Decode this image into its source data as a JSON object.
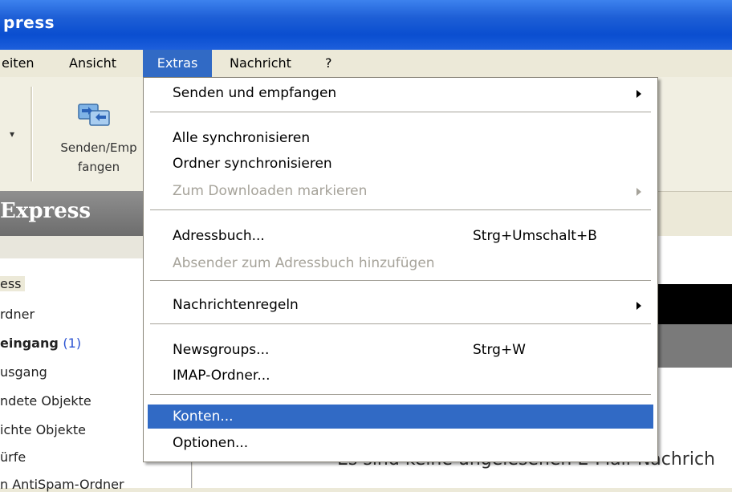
{
  "window": {
    "title": "press"
  },
  "menubar": {
    "items": [
      {
        "label": "eiten"
      },
      {
        "label": "Ansicht"
      },
      {
        "label": "Extras"
      },
      {
        "label": "Nachricht"
      },
      {
        "label": "?"
      }
    ]
  },
  "toolbar": {
    "send_receive_label_1": "Senden/Emp",
    "send_receive_label_2": "fangen"
  },
  "express_header": "Express",
  "folders": [
    {
      "label": "ess",
      "count": ""
    },
    {
      "label": "rdner",
      "count": ""
    },
    {
      "label": "eingang",
      "count": "(1)"
    },
    {
      "label": "usgang",
      "count": ""
    },
    {
      "label": "ndete Objekte",
      "count": ""
    },
    {
      "label": "ichte Objekte",
      "count": ""
    },
    {
      "label": "ürfe",
      "count": ""
    },
    {
      "label": "n AntiSpam-Ordner",
      "count": ""
    }
  ],
  "content": {
    "text": "Es sind keine ungelesenen E-Mail-Nachrich"
  },
  "extras_menu": {
    "send_receive": "Senden und empfangen",
    "sync_all": "Alle synchronisieren",
    "sync_folder": "Ordner synchronisieren",
    "mark_download": "Zum Downloaden markieren",
    "address_book": "Adressbuch...",
    "address_book_shortcut": "Strg+Umschalt+B",
    "add_sender": "Absender zum Adressbuch hinzufügen",
    "message_rules": "Nachrichtenregeln",
    "newsgroups": "Newsgroups...",
    "newsgroups_shortcut": "Strg+W",
    "imap_folders": "IMAP-Ordner...",
    "accounts": "Konten...",
    "options": "Optionen..."
  },
  "colors": {
    "highlight": "#316ac5",
    "titlebar": "#0a4ed0",
    "disabled_text": "#a6a39a"
  }
}
